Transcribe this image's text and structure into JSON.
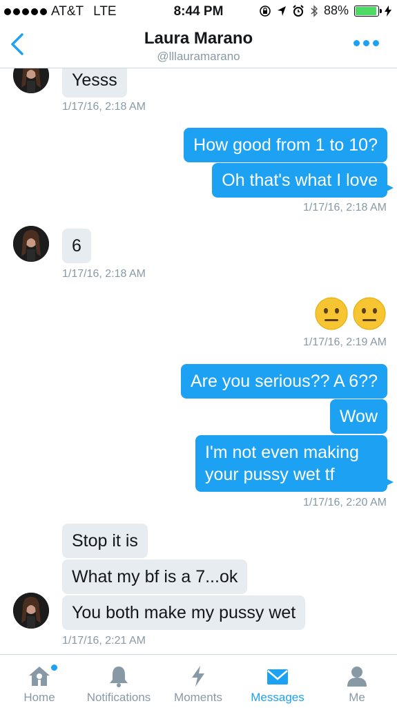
{
  "status": {
    "carrier": "AT&T",
    "network": "LTE",
    "time": "8:44 PM",
    "battery": "88%",
    "battery_level": 0.88
  },
  "header": {
    "name": "Laura Marano",
    "handle": "@lllauramarano"
  },
  "messages": [
    {
      "from": "them",
      "text": "Yesss"
    },
    {
      "timestamp": "1/17/16, 2:18 AM"
    },
    {
      "from": "me",
      "text": "How good from 1 to 10?"
    },
    {
      "from": "me",
      "text": "Oh that's what I love"
    },
    {
      "timestamp": "1/17/16, 2:18 AM"
    },
    {
      "from": "them",
      "text": "6"
    },
    {
      "timestamp": "1/17/16, 2:18 AM"
    },
    {
      "from": "me",
      "emoji": "neutral-face",
      "count": 2
    },
    {
      "timestamp": "1/17/16, 2:19 AM"
    },
    {
      "from": "me",
      "text": "Are you serious?? A 6??"
    },
    {
      "from": "me",
      "text": "Wow"
    },
    {
      "from": "me",
      "text": "I'm not even making your pussy wet tf"
    },
    {
      "timestamp": "1/17/16, 2:20 AM"
    },
    {
      "from": "them",
      "text": "Stop it is"
    },
    {
      "from": "them",
      "text": "What my bf is a 7...ok"
    },
    {
      "from": "them",
      "text": "You both make my pussy wet"
    },
    {
      "timestamp": "1/17/16, 2:21 AM"
    }
  ],
  "tabs": [
    {
      "label": "Home",
      "icon": "home-icon",
      "notification": true
    },
    {
      "label": "Notifications",
      "icon": "bell-icon"
    },
    {
      "label": "Moments",
      "icon": "lightning-icon"
    },
    {
      "label": "Messages",
      "icon": "envelope-icon",
      "active": true
    },
    {
      "label": "Me",
      "icon": "person-icon"
    }
  ],
  "colors": {
    "accent": "#1da1f2",
    "incoming_bubble": "#e6ecf0",
    "muted_text": "#8899a6"
  }
}
